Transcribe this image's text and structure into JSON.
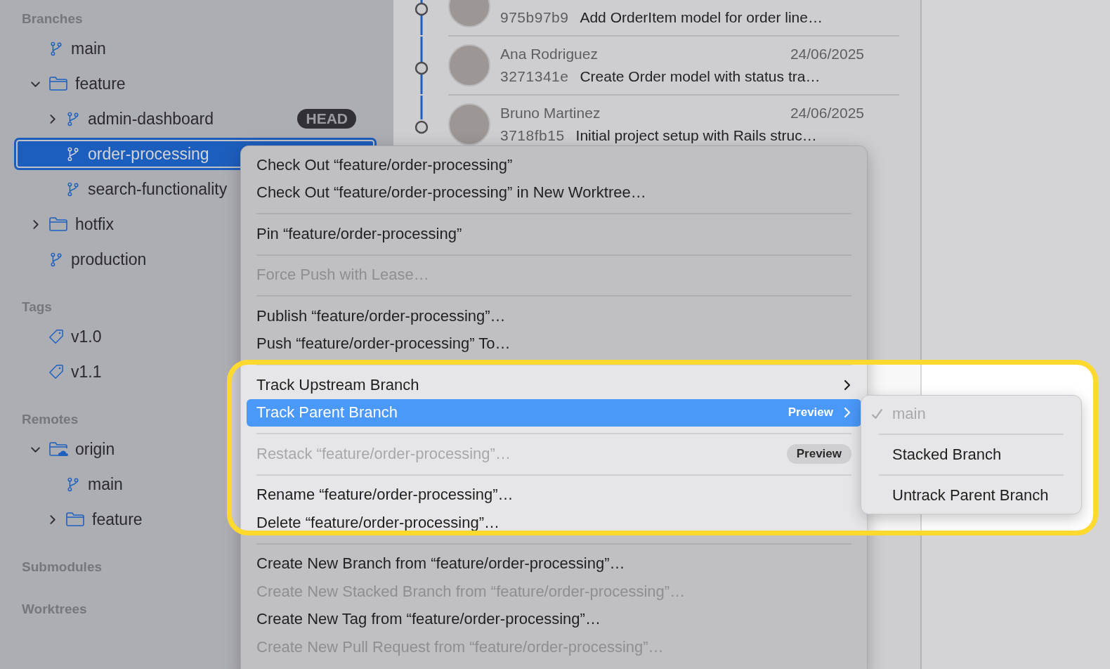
{
  "sidebar": {
    "sections": [
      {
        "title": "Branches",
        "items": [
          {
            "label": "main",
            "kind": "branch",
            "selected": false
          },
          {
            "label": "feature",
            "kind": "folder",
            "selected": false,
            "expanded": true,
            "children": [
              {
                "label": "admin-dashboard",
                "kind": "branch",
                "selected": false,
                "expanded": false,
                "badge": "HEAD"
              },
              {
                "label": "order-processing",
                "kind": "branch",
                "selected": true
              },
              {
                "label": "search-functionality",
                "kind": "branch",
                "selected": false
              }
            ]
          },
          {
            "label": "hotfix",
            "kind": "folder",
            "selected": false,
            "expanded": false
          },
          {
            "label": "production",
            "kind": "branch",
            "selected": false
          }
        ]
      },
      {
        "title": "Tags",
        "items": [
          {
            "label": "v1.0",
            "kind": "tag",
            "selected": false
          },
          {
            "label": "v1.1",
            "kind": "tag",
            "selected": false
          }
        ]
      },
      {
        "title": "Remotes",
        "items": [
          {
            "label": "origin",
            "kind": "remote",
            "selected": false,
            "expanded": true,
            "children": [
              {
                "label": "main",
                "kind": "branch",
                "selected": false
              },
              {
                "label": "feature",
                "kind": "folder",
                "selected": false,
                "expanded": false
              }
            ]
          }
        ]
      },
      {
        "title": "Submodules"
      },
      {
        "title": "Worktrees"
      }
    ]
  },
  "commits": [
    {
      "hash": "975b97b9",
      "message": "Add OrderItem model for order line…"
    },
    {
      "author": "Ana Rodriguez",
      "date": "24/06/2025",
      "hash": "3271341e",
      "message": "Create Order model with status tra…"
    },
    {
      "author": "Bruno Martinez",
      "date": "24/06/2025",
      "hash": "3718fb15",
      "message": "Initial project setup with Rails struc…"
    }
  ],
  "context_menu": {
    "items": [
      {
        "kind": "item",
        "label": "Check Out “feature/order-processing”",
        "disabled": false,
        "selected": false
      },
      {
        "kind": "item",
        "label": "Check Out “feature/order-processing” in New Worktree…",
        "disabled": false,
        "selected": false
      },
      {
        "kind": "separator"
      },
      {
        "kind": "item",
        "label": "Pin “feature/order-processing”",
        "disabled": false,
        "selected": false
      },
      {
        "kind": "separator"
      },
      {
        "kind": "item",
        "label": "Force Push with Lease…",
        "disabled": true,
        "selected": false
      },
      {
        "kind": "separator"
      },
      {
        "kind": "item",
        "label": "Publish “feature/order-processing”…",
        "disabled": false,
        "selected": false
      },
      {
        "kind": "item",
        "label": "Push “feature/order-processing” To…",
        "disabled": false,
        "selected": false
      },
      {
        "kind": "separator"
      },
      {
        "kind": "item",
        "label": "Track Upstream Branch",
        "disabled": false,
        "selected": false,
        "submenu": true
      },
      {
        "kind": "item",
        "label": "Track Parent Branch",
        "disabled": false,
        "selected": true,
        "submenu": true,
        "badge": "Preview"
      },
      {
        "kind": "separator"
      },
      {
        "kind": "item",
        "label": "Restack “feature/order-processing”…",
        "disabled": true,
        "selected": false,
        "badge": "Preview"
      },
      {
        "kind": "separator"
      },
      {
        "kind": "item",
        "label": "Rename “feature/order-processing”…",
        "disabled": false,
        "selected": false
      },
      {
        "kind": "item",
        "label": "Delete “feature/order-processing”…",
        "disabled": false,
        "selected": false
      },
      {
        "kind": "separator"
      },
      {
        "kind": "item",
        "label": "Create New Branch from “feature/order-processing”…",
        "disabled": false,
        "selected": false
      },
      {
        "kind": "item",
        "label": "Create New Stacked Branch from “feature/order-processing”…",
        "disabled": true,
        "selected": false
      },
      {
        "kind": "item",
        "label": "Create New Tag from “feature/order-processing”…",
        "disabled": false,
        "selected": false
      },
      {
        "kind": "item",
        "label": "Create New Pull Request from “feature/order-processing”…",
        "disabled": true,
        "selected": false
      }
    ]
  },
  "submenu": {
    "items": [
      {
        "kind": "item",
        "label": "main",
        "checked": true,
        "disabled": true
      },
      {
        "kind": "separator"
      },
      {
        "kind": "item",
        "label": "Stacked Branch",
        "checked": false,
        "disabled": false
      },
      {
        "kind": "separator"
      },
      {
        "kind": "item",
        "label": "Untrack Parent Branch",
        "checked": false,
        "disabled": false
      }
    ]
  }
}
